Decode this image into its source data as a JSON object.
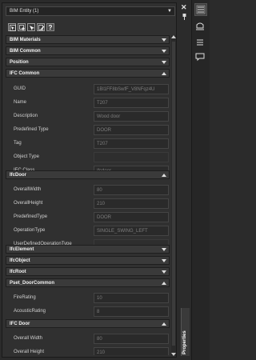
{
  "panel": {
    "entity_selector": "BIM Entity (1)",
    "toolbar_help": "?"
  },
  "sections": {
    "bim_materials": "BIM Materials",
    "bim_common": "BIM Common",
    "position": "Position",
    "ifc_common": "IFC Common",
    "ifc_door": "IfcDoor",
    "ifc_element": "IfcElement",
    "ifc_object": "IfcObject",
    "ifc_root": "IfcRoot",
    "pset_door_common": "Pset_DoorCommon",
    "ifc_door2": "IFC Door"
  },
  "ifc_common_props": [
    {
      "label": "GUID",
      "value": "1Bl1FF8bSwfF_V8NFqz4U"
    },
    {
      "label": "Name",
      "value": "T207"
    },
    {
      "label": "Description",
      "value": "Wood door"
    },
    {
      "label": "Predefined Type",
      "value": "DOOR"
    },
    {
      "label": "Tag",
      "value": "T207"
    },
    {
      "label": "Object Type",
      "value": ""
    },
    {
      "label": "IFC Class",
      "value": "ifcdoor"
    }
  ],
  "ifcdoor_props": [
    {
      "label": "OverallWidth",
      "value": "80"
    },
    {
      "label": "OverallHeight",
      "value": "210"
    },
    {
      "label": "PredefinedType",
      "value": "DOOR"
    },
    {
      "label": "OperationType",
      "value": "SINGLE_SWING_LEFT"
    },
    {
      "label": "UserDefinedOperationType",
      "value": ""
    }
  ],
  "pset_props": [
    {
      "label": "FireRating",
      "value": "10"
    },
    {
      "label": "AcousticRating",
      "value": "8"
    }
  ],
  "ifc_door2_props": [
    {
      "label": "Overall Width",
      "value": "80"
    },
    {
      "label": "Overall Height",
      "value": "210"
    }
  ],
  "dock": {
    "close": "✕",
    "properties_tab": "Properties"
  },
  "colors": {
    "panel_bg": "#303030",
    "section_bg": "#3a3a3a",
    "value_text": "#7d7d7d"
  }
}
